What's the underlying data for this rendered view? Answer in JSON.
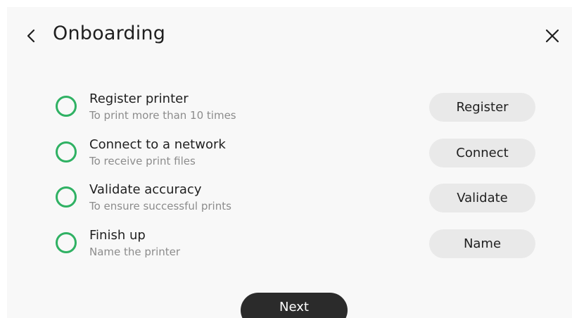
{
  "header": {
    "title": "Onboarding",
    "back_icon": "chevron-left-icon",
    "close_icon": "close-icon"
  },
  "steps": [
    {
      "title": "Register printer",
      "subtitle": "To print more than 10 times",
      "button": "Register"
    },
    {
      "title": "Connect to a network",
      "subtitle": "To receive print files",
      "button": "Connect"
    },
    {
      "title": "Validate accuracy",
      "subtitle": "To ensure successful prints",
      "button": "Validate"
    },
    {
      "title": "Finish up",
      "subtitle": "Name the printer",
      "button": "Name"
    }
  ],
  "footer": {
    "next_label": "Next"
  },
  "colors": {
    "step_indicator": "#2fb163",
    "primary_button": "#2b2b2b",
    "secondary_button": "#e9e9e9",
    "background": "#f8f8f8"
  }
}
